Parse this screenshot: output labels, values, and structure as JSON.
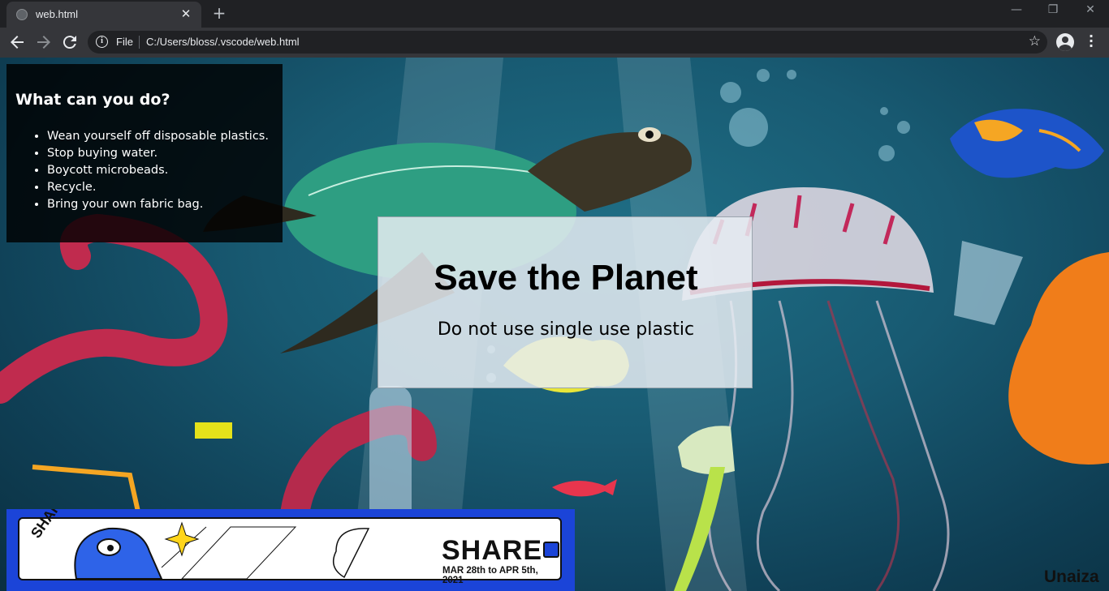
{
  "browser": {
    "tab": {
      "title": "web.html"
    },
    "address": {
      "scheme_label": "File",
      "url": "C:/Users/bloss/.vscode/web.html"
    }
  },
  "icons": {
    "back": "arrow-left",
    "forward": "arrow-right",
    "reload": "reload",
    "info": "info",
    "bookmark": "star",
    "profile": "account-circle",
    "menu": "vertical-dots",
    "new_tab": "plus",
    "close_tab": "x"
  },
  "panel": {
    "title": "What can you do?",
    "items": [
      "Wean yourself off disposable plastics.",
      "Stop buying water.",
      "Boycott microbeads.",
      "Recycle.",
      "Bring your own fabric bag."
    ]
  },
  "card": {
    "title": "Save the Planet",
    "subtitle": "Do not use single use plastic"
  },
  "banner": {
    "logo_text": "SHARE",
    "headline": "SHARE",
    "dates": "MAR 28th to APR 5th, 2021"
  },
  "signature": "Unaiza",
  "colors": {
    "chrome_dark": "#202124",
    "chrome_toolbar": "#35363a",
    "ocean": "#185a72",
    "banner_blue": "#1b44d8"
  }
}
